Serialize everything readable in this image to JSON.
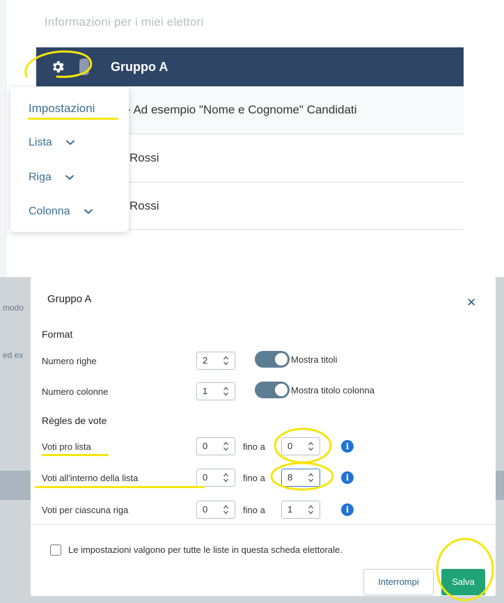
{
  "top": {
    "section_title": "Informazioni per i miei elettori",
    "group_name": "Gruppo A",
    "rows": [
      "- Ad esempio \"Nome e Cognome\" Candidati",
      "Rossi",
      "Rossi"
    ],
    "menu": {
      "items": [
        "Impostazioni",
        "Lista",
        "Riga",
        "Colonna"
      ]
    }
  },
  "background": {
    "text_1": "modo",
    "text_2": "ed ex"
  },
  "modal": {
    "title": "Gruppo A",
    "close_symbol": "✕",
    "format_heading": "Format",
    "rows_label": "Numero righe",
    "rows_value": "2",
    "show_titles_label": "Mostra titoli",
    "cols_label": "Numero colonne",
    "cols_value": "1",
    "show_col_title_label": "Mostra titolo colonna",
    "rules_heading": "Règles de vote",
    "vote_rows": [
      {
        "label": "Voti pro lista",
        "from": "0",
        "to_label": "fino a",
        "to": "0"
      },
      {
        "label": "Voti all'interno della lista",
        "from": "0",
        "to_label": "fino a",
        "to": "8"
      },
      {
        "label": "Voti per ciascuna riga",
        "from": "0",
        "to_label": "fino a",
        "to": "1"
      }
    ],
    "info_symbol": "i",
    "apply_all_label": "Le impostazioni valgono per tutte le liste in questa scheda elettorale.",
    "cancel_label": "Interrompi",
    "save_label": "Salva"
  },
  "colors": {
    "header_bg": "#2e4566",
    "link_blue": "#3c6e93",
    "save_green": "#20a477",
    "toggle_on": "#5d7d93",
    "annotation_yellow": "#f5e50c"
  }
}
